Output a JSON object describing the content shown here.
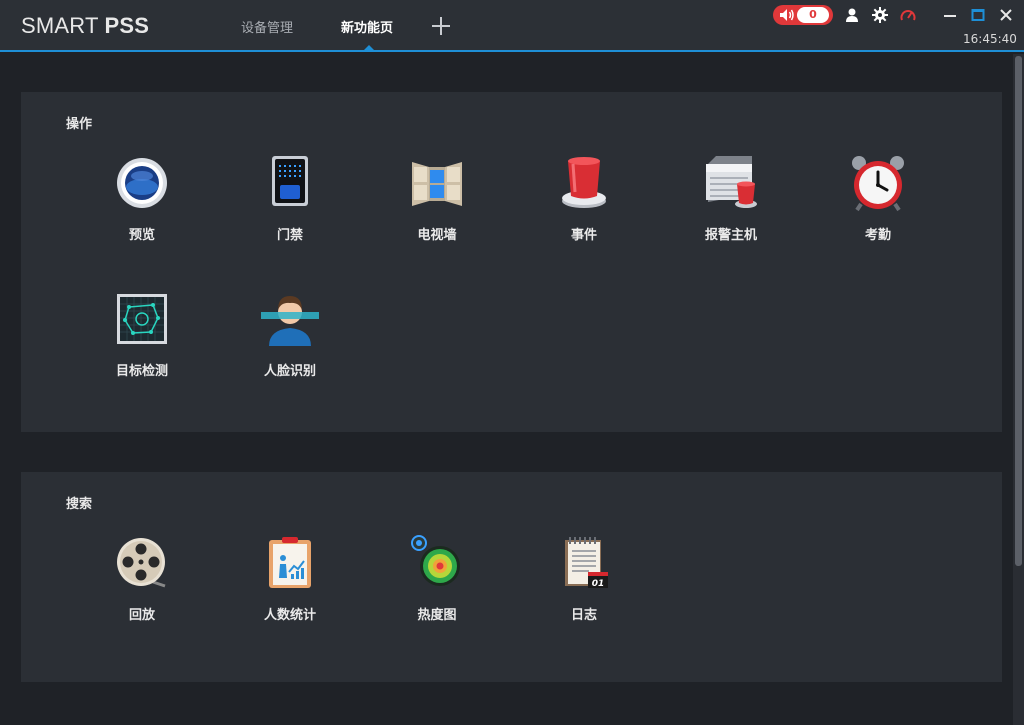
{
  "app": {
    "brand_light": "SMART ",
    "brand_bold": "PSS",
    "tabs": [
      {
        "label": "设备管理",
        "active": false
      },
      {
        "label": "新功能页",
        "active": true
      }
    ],
    "alarm_count": "0",
    "clock": "16:45:40",
    "accent_color": "#1e8fd6",
    "alarm_color": "#e0383a"
  },
  "sections": {
    "operations": {
      "title": "操作",
      "items": [
        {
          "label": "预览",
          "icon": "preview-icon"
        },
        {
          "label": "门禁",
          "icon": "access-control-icon"
        },
        {
          "label": "电视墙",
          "icon": "video-wall-icon"
        },
        {
          "label": "事件",
          "icon": "event-icon"
        },
        {
          "label": "报警主机",
          "icon": "alarm-host-icon"
        },
        {
          "label": "考勤",
          "icon": "attendance-clock-icon"
        },
        {
          "label": "目标检测",
          "icon": "target-detection-icon"
        },
        {
          "label": "人脸识别",
          "icon": "face-recognition-icon"
        }
      ]
    },
    "search": {
      "title": "搜索",
      "items": [
        {
          "label": "回放",
          "icon": "playback-icon"
        },
        {
          "label": "人数统计",
          "icon": "people-counting-icon"
        },
        {
          "label": "热度图",
          "icon": "heat-map-icon"
        },
        {
          "label": "日志",
          "icon": "log-icon"
        }
      ]
    }
  }
}
